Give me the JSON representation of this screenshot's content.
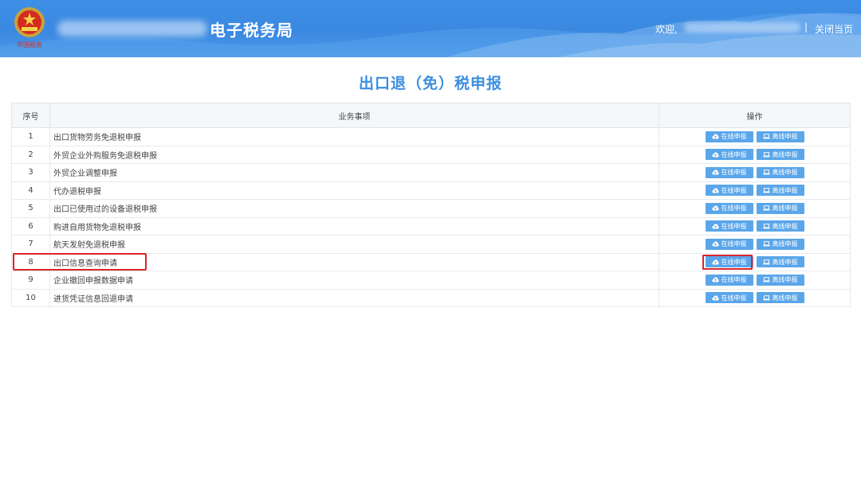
{
  "header": {
    "site_suffix": "电子税务局",
    "welcome": "欢迎,",
    "separator": "|",
    "close_page": "关闭当页",
    "emblem_text": "中国税务"
  },
  "page": {
    "title": "出口退（免）税申报"
  },
  "table": {
    "headers": [
      "序号",
      "业务事项",
      "操作"
    ],
    "online_label": "在线申报",
    "offline_label": "离线申报",
    "rows": [
      {
        "index": "1",
        "name": "出口货物劳务免退税申报"
      },
      {
        "index": "2",
        "name": "外贸企业外购服务免退税申报"
      },
      {
        "index": "3",
        "name": "外贸企业调整申报"
      },
      {
        "index": "4",
        "name": "代办退税申报"
      },
      {
        "index": "5",
        "name": "出口已使用过的设备退税申报"
      },
      {
        "index": "6",
        "name": "购进自用货物免退税申报"
      },
      {
        "index": "7",
        "name": "航天发射免退税申报"
      },
      {
        "index": "8",
        "name": "出口信息查询申请"
      },
      {
        "index": "9",
        "name": "企业撤回申报数据申请"
      },
      {
        "index": "10",
        "name": "进货凭证信息回退申请"
      }
    ]
  },
  "colors": {
    "header_blue": "#3a88e0",
    "button_blue": "#5aa6ea",
    "highlight_red": "#d9262a",
    "title_blue": "#3b8ee0"
  },
  "icons": {
    "online": "cloud-upload-icon",
    "offline": "laptop-icon"
  }
}
